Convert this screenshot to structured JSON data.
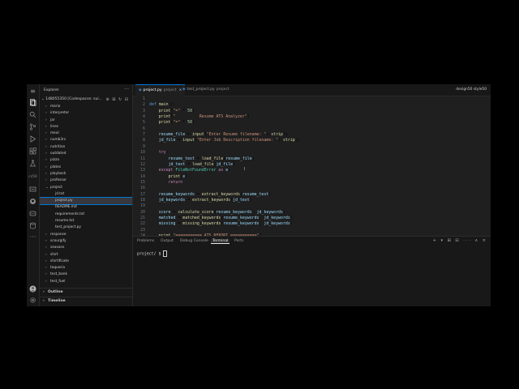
{
  "activity_bar": {
    "icons": [
      "menu-icon",
      "explorer-icon",
      "search-icon",
      "source-control-icon",
      "run-debug-icon",
      "extensions-icon",
      "testing-icon",
      "cs50-icon",
      "ports-icon",
      "github-icon",
      "copilot-icon",
      "database-icon",
      "more-icon",
      "account-icon",
      "settings-icon"
    ],
    "cs50_label": "cs50"
  },
  "sidebar": {
    "title": "Explorer",
    "more": "···",
    "root_label": "148055350 [Codespaces: sui...",
    "actions": "⊕ ⊞ ↻ ⊟",
    "items": [
      {
        "label": "mario",
        "chev": "›",
        "indent": 0
      },
      {
        "label": "interpreter",
        "chev": "›",
        "indent": 0
      },
      {
        "label": "jar",
        "chev": "›",
        "indent": 0
      },
      {
        "label": "lines",
        "chev": "›",
        "indent": 0
      },
      {
        "label": "meal",
        "chev": "›",
        "indent": 0
      },
      {
        "label": "numb3rs",
        "chev": "›",
        "indent": 0
      },
      {
        "label": "nutrition",
        "chev": "›",
        "indent": 0
      },
      {
        "label": "outdated",
        "chev": "›",
        "indent": 0
      },
      {
        "label": "pizza",
        "chev": "›",
        "indent": 0
      },
      {
        "label": "plates",
        "chev": "›",
        "indent": 0
      },
      {
        "label": "playback",
        "chev": "›",
        "indent": 0
      },
      {
        "label": "professor",
        "chev": "›",
        "indent": 0
      },
      {
        "label": "project",
        "chev": "⌄",
        "indent": 0
      },
      {
        "label": "jd.txt",
        "chev": "",
        "indent": 1
      },
      {
        "label": "project.py",
        "chev": "",
        "indent": 1,
        "selected": true
      },
      {
        "label": "README.md",
        "chev": "",
        "indent": 1
      },
      {
        "label": "requirements.txt",
        "chev": "",
        "indent": 1
      },
      {
        "label": "resume.txt",
        "chev": "",
        "indent": 1
      },
      {
        "label": "test_project.py",
        "chev": "",
        "indent": 1
      },
      {
        "label": "response",
        "chev": "›",
        "indent": 0
      },
      {
        "label": "scourgify",
        "chev": "›",
        "indent": 0
      },
      {
        "label": "seasons",
        "chev": "›",
        "indent": 0
      },
      {
        "label": "shirt",
        "chev": "›",
        "indent": 0
      },
      {
        "label": "shirtificate",
        "chev": "›",
        "indent": 0
      },
      {
        "label": "taqueria",
        "chev": "›",
        "indent": 0
      },
      {
        "label": "test_bank",
        "chev": "›",
        "indent": 0
      },
      {
        "label": "test_fuel",
        "chev": "›",
        "indent": 0
      }
    ],
    "outline_label": "Outline",
    "timeline_label": "Timeline"
  },
  "editor": {
    "tabs": [
      {
        "label": "project.py",
        "sub": "project",
        "active": true
      },
      {
        "label": "test_project.py",
        "sub": "project",
        "active": false
      }
    ],
    "topright": "design50   style50",
    "lines": [
      {
        "n": "1",
        "code": ""
      },
      {
        "n": "2",
        "code": "def main():"
      },
      {
        "n": "3",
        "code": "    print(\"=\" * 50)"
      },
      {
        "n": "4",
        "code": "    print(\"          Resume ATS Analyzer\")"
      },
      {
        "n": "5",
        "code": "    print(\"=\" * 50)"
      },
      {
        "n": "6",
        "code": ""
      },
      {
        "n": "7",
        "code": "    resume_file = input(\"Enter Resume filename: \").strip()"
      },
      {
        "n": "8",
        "code": "    jd_file = input(\"Enter Job Description filename: \").strip()"
      },
      {
        "n": "9",
        "code": ""
      },
      {
        "n": "10",
        "code": "    try:"
      },
      {
        "n": "11",
        "code": "        resume_text = load_file(resume_file)"
      },
      {
        "n": "12",
        "code": "        jd_text = load_file(jd_file)"
      },
      {
        "n": "13",
        "code": "    except FileNotFoundError as e:"
      },
      {
        "n": "14",
        "code": "        print(e)"
      },
      {
        "n": "15",
        "code": "        return"
      },
      {
        "n": "16",
        "code": ""
      },
      {
        "n": "17",
        "code": "    resume_keywords = extract_keywords(resume_text)"
      },
      {
        "n": "18",
        "code": "    jd_keywords = extract_keywords(jd_text)"
      },
      {
        "n": "19",
        "code": ""
      },
      {
        "n": "20",
        "code": "    score = calculate_score(resume_keywords, jd_keywords)"
      },
      {
        "n": "21",
        "code": "    matched = matched_keywords(resume_keywords, jd_keywords)"
      },
      {
        "n": "22",
        "code": "    missing = missing_keywords(resume_keywords, jd_keywords)"
      },
      {
        "n": "23",
        "code": ""
      },
      {
        "n": "24",
        "code": "    print(\"=========== ATS REPORT ===========\")"
      }
    ]
  },
  "panel": {
    "tabs": [
      "Problems",
      "Output",
      "Debug Console",
      "Terminal",
      "Ports"
    ],
    "active_tab": "Terminal",
    "actions": "+ ▾ ⊞ ⊟ ··· ∧ ×",
    "prompt": "project/ $ "
  }
}
